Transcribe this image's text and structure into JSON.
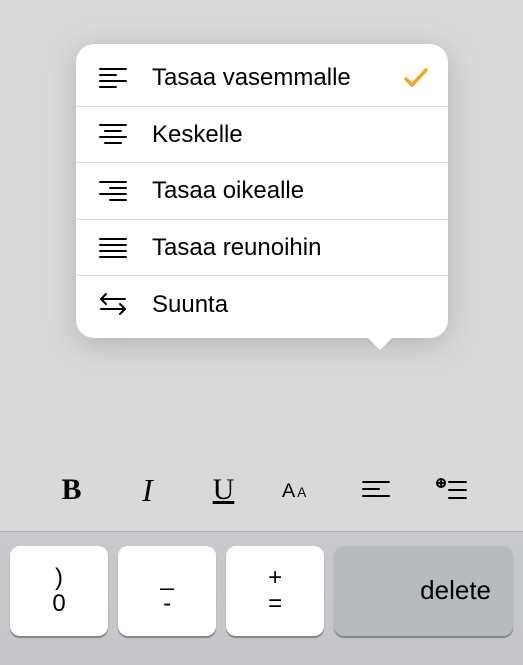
{
  "popover": {
    "items": [
      {
        "label": "Tasaa vasemmalle",
        "icon": "align-left-icon",
        "selected": true
      },
      {
        "label": "Keskelle",
        "icon": "align-center-icon",
        "selected": false
      },
      {
        "label": "Tasaa oikealle",
        "icon": "align-right-icon",
        "selected": false
      },
      {
        "label": "Tasaa reunoihin",
        "icon": "align-justify-icon",
        "selected": false
      },
      {
        "label": "Suunta",
        "icon": "direction-icon",
        "selected": false
      }
    ]
  },
  "toolbar": {
    "bold_label": "B",
    "italic_label": "I",
    "underline_label": "U",
    "textsize_label": "AA",
    "align_icon": "align-left-icon",
    "list_icon": "add-list-icon"
  },
  "keyboard": {
    "keys": [
      {
        "top": ")",
        "bottom": "0"
      },
      {
        "top": "_",
        "bottom": "-"
      },
      {
        "top": "+",
        "bottom": "="
      }
    ],
    "delete_label": "delete"
  },
  "colors": {
    "accent": "#f5a623"
  }
}
